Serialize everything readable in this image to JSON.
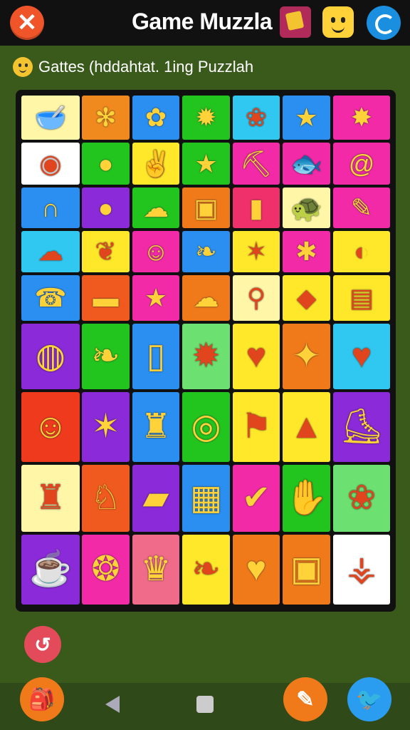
{
  "header": {
    "title": "Game Muzzla",
    "close_glyph": "✕",
    "icons": [
      "book-icon",
      "smiley-icon",
      "refresh-icon"
    ]
  },
  "status": {
    "text": "Gattes (hddahtat. 1ing Puzzlah",
    "icon": "smiley-emoji-icon"
  },
  "board": {
    "rows": [
      [
        {
          "bg": "#fff6a8",
          "g": "🥣",
          "n": "bowl"
        },
        {
          "bg": "#f08a1e",
          "g": "✻",
          "n": "starfish"
        },
        {
          "bg": "#2a8ff0",
          "g": "✿",
          "n": "flower"
        },
        {
          "bg": "#22c41e",
          "g": "✹",
          "n": "sun"
        },
        {
          "bg": "#30c8f0",
          "g": "❀",
          "n": "gear-flower"
        },
        {
          "bg": "#2a8ff0",
          "g": "★",
          "n": "star"
        },
        {
          "bg": "#f22aa8",
          "g": "✸",
          "n": "burst"
        }
      ],
      [
        {
          "bg": "#ffffff",
          "g": "◉",
          "n": "coin"
        },
        {
          "bg": "#22c41e",
          "g": "●",
          "n": "ball"
        },
        {
          "bg": "#ffe82a",
          "g": "✌",
          "n": "hands"
        },
        {
          "bg": "#22c41e",
          "g": "★",
          "n": "star-green"
        },
        {
          "bg": "#f22aa8",
          "g": "⛏",
          "n": "pickaxe"
        },
        {
          "bg": "#f22aa8",
          "g": "🐟",
          "n": "fish"
        },
        {
          "bg": "#f22aa8",
          "g": "@",
          "n": "spiral"
        }
      ],
      [
        {
          "bg": "#2a8ff0",
          "g": "∩",
          "n": "magnet"
        },
        {
          "bg": "#8a2ad8",
          "g": "●",
          "n": "orange-dot"
        },
        {
          "bg": "#22c41e",
          "g": "☁",
          "n": "cloud-face"
        },
        {
          "bg": "#f07a1a",
          "g": "▣",
          "n": "radio"
        },
        {
          "bg": "#f0306a",
          "g": "▮",
          "n": "battery"
        },
        {
          "bg": "#fff6a8",
          "g": "🐢",
          "n": "turtle"
        },
        {
          "bg": "#f22aa8",
          "g": "✎",
          "n": "feather"
        }
      ],
      [
        {
          "bg": "#30c8f0",
          "g": "☁",
          "n": "cloud"
        },
        {
          "bg": "#ffe82a",
          "g": "❦",
          "n": "leaf-red"
        },
        {
          "bg": "#f22aa8",
          "g": "☺",
          "n": "chick"
        },
        {
          "bg": "#2a8ff0",
          "g": "❧",
          "n": "leaf"
        },
        {
          "bg": "#ffe82a",
          "g": "✶",
          "n": "star-orange"
        },
        {
          "bg": "#f22aa8",
          "g": "✱",
          "n": "splat"
        },
        {
          "bg": "#ffe82a",
          "g": "◐",
          "n": "planet"
        }
      ],
      [
        {
          "bg": "#2a8ff0",
          "g": "☎",
          "n": "phone"
        },
        {
          "bg": "#f05a1e",
          "g": "▬",
          "n": "eraser"
        },
        {
          "bg": "#f22aa8",
          "g": "★",
          "n": "star-blue"
        },
        {
          "bg": "#f07a1a",
          "g": "☁",
          "n": "cloud-pink"
        },
        {
          "bg": "#fff6a8",
          "g": "⚲",
          "n": "key"
        },
        {
          "bg": "#ffe82a",
          "g": "◆",
          "n": "gem"
        },
        {
          "bg": "#ffe82a",
          "g": "▤",
          "n": "box"
        }
      ],
      [
        {
          "bg": "#8a2ad8",
          "g": "◍",
          "n": "ball-stick"
        },
        {
          "bg": "#22c41e",
          "g": "❧",
          "n": "leaf-orange"
        },
        {
          "bg": "#2a8ff0",
          "g": "▯",
          "n": "jar"
        },
        {
          "bg": "#6ce070",
          "g": "✹",
          "n": "sun-burst"
        },
        {
          "bg": "#ffe82a",
          "g": "♥",
          "n": "apple"
        },
        {
          "bg": "#f07a1a",
          "g": "✦",
          "n": "sparkle"
        },
        {
          "bg": "#30c8f0",
          "g": "♥",
          "n": "heart"
        }
      ],
      [
        {
          "bg": "#f03a1e",
          "g": "☺",
          "n": "smile-face"
        },
        {
          "bg": "#8a2ad8",
          "g": "✶",
          "n": "planet-ring"
        },
        {
          "bg": "#2a8ff0",
          "g": "♜",
          "n": "bottle"
        },
        {
          "bg": "#22c41e",
          "g": "◎",
          "n": "target"
        },
        {
          "bg": "#ffe82a",
          "g": "⚑",
          "n": "pin"
        },
        {
          "bg": "#ffe82a",
          "g": "▲",
          "n": "wizard-hat"
        },
        {
          "bg": "#8a2ad8",
          "g": "⛸",
          "n": "boot"
        }
      ],
      [
        {
          "bg": "#fff6a8",
          "g": "♜",
          "n": "jug"
        },
        {
          "bg": "#f05a1e",
          "g": "♘",
          "n": "horse"
        },
        {
          "bg": "#8a2ad8",
          "g": "▰",
          "n": "crayon"
        },
        {
          "bg": "#2a8ff0",
          "g": "▦",
          "n": "basket"
        },
        {
          "bg": "#f22aa8",
          "g": "✔",
          "n": "phone-check"
        },
        {
          "bg": "#22c41e",
          "g": "✋",
          "n": "carrot"
        },
        {
          "bg": "#6ce070",
          "g": "❀",
          "n": "crab"
        }
      ],
      [
        {
          "bg": "#8a2ad8",
          "g": "☕",
          "n": "cup"
        },
        {
          "bg": "#f22aa8",
          "g": "❂",
          "n": "shield"
        },
        {
          "bg": "#f06a8a",
          "g": "♛",
          "n": "cage"
        },
        {
          "bg": "#ffe82a",
          "g": "❧",
          "n": "leaf-green"
        },
        {
          "bg": "#f07a1a",
          "g": "♥",
          "n": "heart-split"
        },
        {
          "bg": "#f07a1a",
          "g": "▣",
          "n": "monitor"
        },
        {
          "bg": "#ffffff",
          "g": "⚶",
          "n": "pen"
        }
      ]
    ]
  },
  "buttons": {
    "swap": "↺",
    "bag": "🎒",
    "pencil": "✎",
    "twitter": "🐦"
  }
}
